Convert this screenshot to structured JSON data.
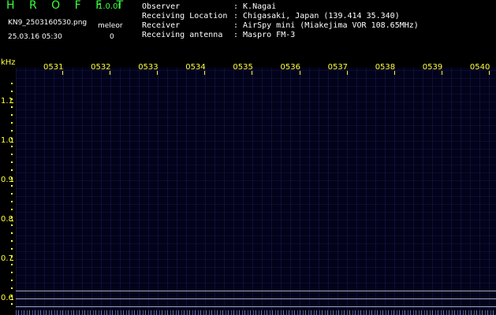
{
  "header": {
    "app_title": "H R O F F T",
    "version": "1.0.0f",
    "filename": "KN9_2503160530.png",
    "meleor_label": "meleor",
    "datetime": "25.03.16 05:30",
    "meleor_value": "0"
  },
  "info": [
    {
      "key": "Observer",
      "value": ": K.Nagai"
    },
    {
      "key": "Receiving Location",
      "value": ": Chigasaki, Japan (139.414 35.340)"
    },
    {
      "key": "Receiver",
      "value": ": AirSpy mini (Miakejima VOR 108.65MHz)"
    },
    {
      "key": "Receiving antenna",
      "value": ": Maspro FM-3"
    }
  ],
  "colors": {
    "title": "#3cff3c",
    "axis": "#ffff3c",
    "background": "#000000",
    "plot": "#02021a"
  },
  "spectrogram": {
    "y_unit": "kHz",
    "x_ticks": [
      "0531",
      "0532",
      "0533",
      "0534",
      "0535",
      "0536",
      "0537",
      "0538",
      "0539",
      "0540"
    ],
    "y_ticks": [
      "1.1",
      "1.0",
      "0.9",
      "0.8",
      "0.7",
      "0.6"
    ],
    "y_range": [
      0.6,
      1.15
    ]
  }
}
